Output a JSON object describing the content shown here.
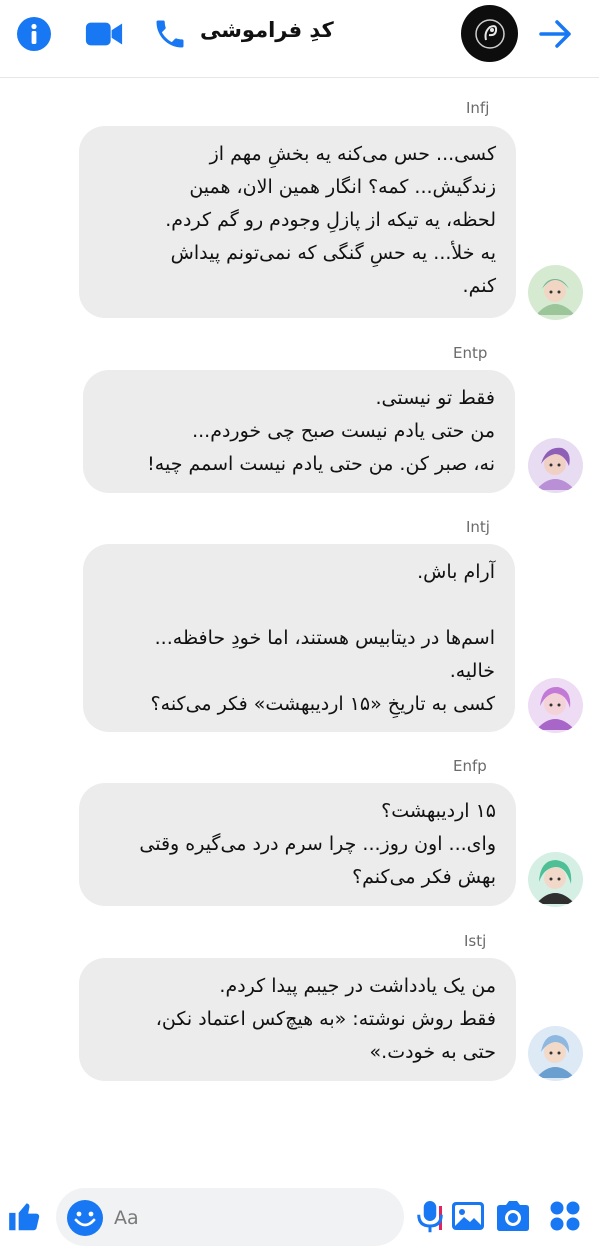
{
  "header": {
    "title": "کدِ فراموشی",
    "icons": [
      "info-icon",
      "video-camera-icon",
      "phone-icon",
      "back-arrow-icon"
    ],
    "accent": "#1877f2"
  },
  "messages": [
    {
      "sender": "Infj",
      "text": "کسی... حس می‌کنه یه بخشِ مهم از\nزندگیش... کمه؟ انگار همین الان، همین\nلحظه، یه تیکه از پازلِ وجودم رو گم کردم.\nیه خلأ... یه حسِ گنگی که نمی‌تونم پیداش\nکنم."
    },
    {
      "sender": "Entp",
      "text": "فقط تو نیستی.\nمن حتی یادم نیست صبح چی خوردم...\nنه، صبر کن. من حتی یادم نیست اسمم چیه!"
    },
    {
      "sender": "Intj",
      "text": "آرام باش.\n\nاسم‌ها در دیتابیس هستند، اما خودِ حافظه...\nخالیه.\nکسی به تاریخِ «۱۵ اردیبهشت» فکر می‌کنه؟"
    },
    {
      "sender": "Enfp",
      "text": "۱۵ اردیبهشت؟\nوای... اون روز... چرا سرم درد می‌گیره وقتی\nبهش فکر می‌کنم؟"
    },
    {
      "sender": "Istj",
      "text": "من یک یادداشت در جیبم پیدا کردم.\nفقط روش نوشته: «به هیچ‌کس اعتماد نکن،\nحتی به خودت.»"
    }
  ],
  "composer": {
    "placeholder": "Aa"
  },
  "colors": {
    "bubble": "#ececec",
    "icon_blue": "#1877f2"
  }
}
